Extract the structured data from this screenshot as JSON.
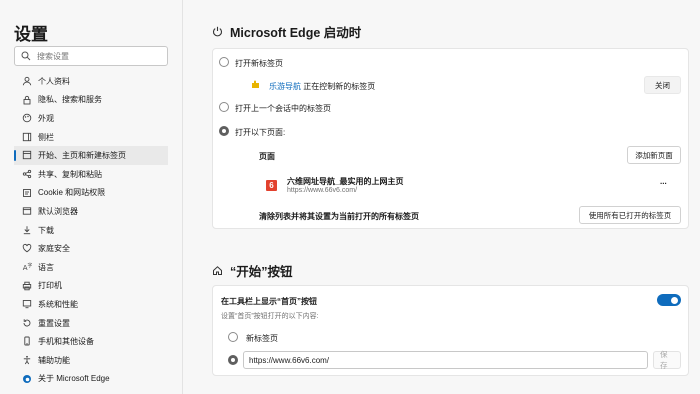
{
  "sidebar": {
    "title": "设置",
    "search_placeholder": "搜索设置",
    "items": [
      {
        "label": "个人资料",
        "icon": "profile-icon"
      },
      {
        "label": "隐私、搜索和服务",
        "icon": "lock-icon"
      },
      {
        "label": "外观",
        "icon": "appearance-icon"
      },
      {
        "label": "侧栏",
        "icon": "sidebar-icon"
      },
      {
        "label": "开始、主页和新建标签页",
        "icon": "start-page-icon",
        "active": true
      },
      {
        "label": "共享、复制和粘贴",
        "icon": "share-icon"
      },
      {
        "label": "Cookie 和网站权限",
        "icon": "cookie-icon"
      },
      {
        "label": "默认浏览器",
        "icon": "browser-icon"
      },
      {
        "label": "下载",
        "icon": "download-icon"
      },
      {
        "label": "家庭安全",
        "icon": "family-icon"
      },
      {
        "label": "语言",
        "icon": "language-icon"
      },
      {
        "label": "打印机",
        "icon": "printer-icon"
      },
      {
        "label": "系统和性能",
        "icon": "system-icon"
      },
      {
        "label": "重置设置",
        "icon": "reset-icon"
      },
      {
        "label": "手机和其他设备",
        "icon": "phone-icon"
      },
      {
        "label": "辅助功能",
        "icon": "accessibility-icon"
      },
      {
        "label": "关于 Microsoft Edge",
        "icon": "edge-icon"
      }
    ]
  },
  "startup": {
    "heading": "Microsoft Edge 启动时",
    "option_new_tab": "打开新标签页",
    "extension_name": "乐游导航",
    "extension_text": "正在控制新的标签页",
    "close_button": "关闭",
    "option_prev_session": "打开上一个会话中的标签页",
    "option_pages": "打开以下页面:",
    "pages_label": "页面",
    "add_page_button": "添加新页面",
    "page_title": "六维网址导航_最实用的上网主页",
    "page_url": "https://www.66v6.com/",
    "page_favicon": "6",
    "more_icon": "...",
    "clear_text": "清除列表并将其设置为当前打开的所有标签页",
    "use_all_button": "使用所有已打开的标签页"
  },
  "home_button": {
    "heading": "“开始”按钮",
    "toggle_label": "在工具栏上显示“首页”按钮",
    "toggle_sub": "设置“首页”按钮打开的以下内容:",
    "toggle_on": true,
    "option_new_tab": "新标签页",
    "url_value": "https://www.66v6.com/",
    "save_button": "保存"
  },
  "colors": {
    "accent": "#0f6cbd",
    "favicon": "#e2412e"
  }
}
